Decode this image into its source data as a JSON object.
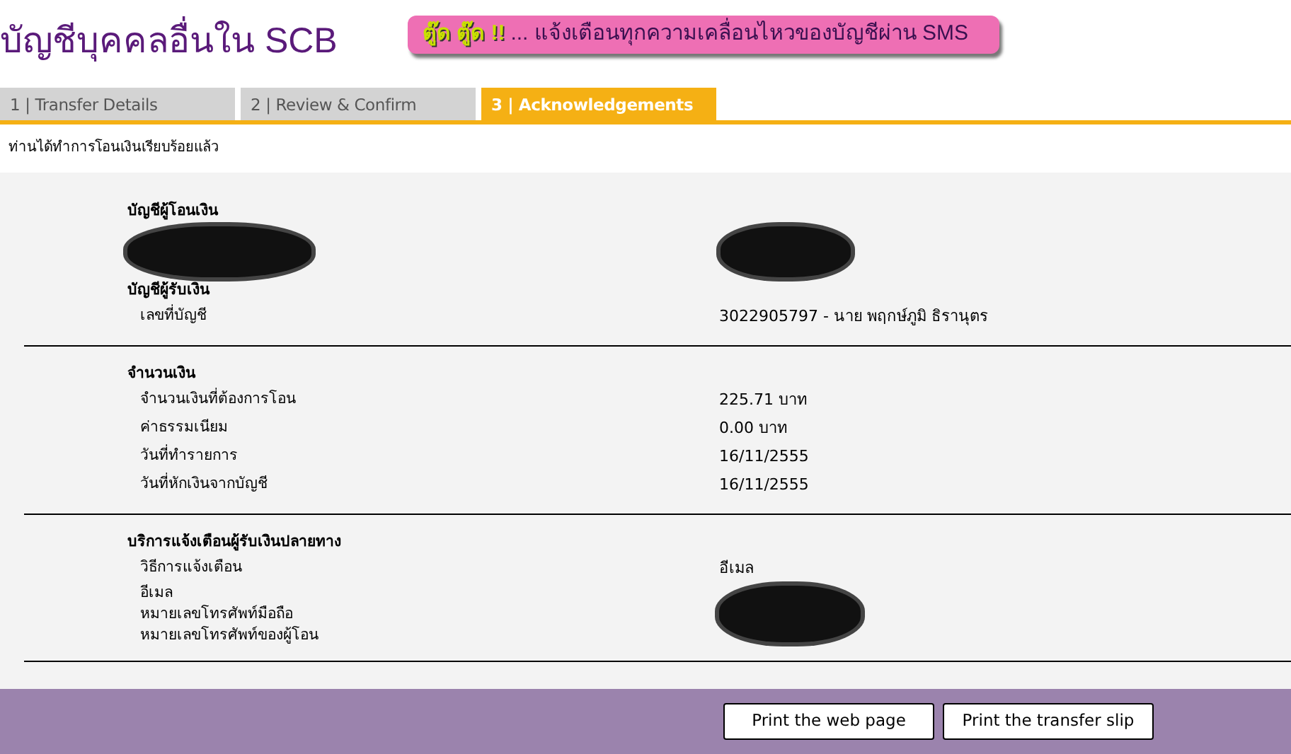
{
  "header": {
    "title": "บัญชีบุคคลอื่นใน SCB",
    "banner": {
      "highlight": "ตู๊ด ตู๊ด !!",
      "text": "... แจ้งเตือนทุกความเคลื่อนไหวของบัญชีผ่าน SMS"
    }
  },
  "tabs": [
    {
      "label": "1 | Transfer Details",
      "selected": false
    },
    {
      "label": "2 | Review & Confirm",
      "selected": false
    },
    {
      "label": "3 | Acknowledgements",
      "selected": true
    }
  ],
  "message": "ท่านได้ทำการโอนเงินเรียบร้อยแล้ว",
  "sections": [
    {
      "items": [
        {
          "kind": "heading",
          "label": "บัญชีผู้โอนเงิน"
        },
        {
          "kind": "hidden"
        },
        {
          "kind": "heading",
          "label": "บัญชีผู้รับเงิน"
        },
        {
          "kind": "row",
          "label": "เลขที่บัญชี",
          "value": "3022905797 - นาย พฤกษ์ภูมิ ธิรานุตร"
        }
      ]
    },
    {
      "items": [
        {
          "kind": "heading",
          "label": "จำนวนเงิน"
        },
        {
          "kind": "row",
          "label": "จำนวนเงินที่ต้องการโอน",
          "value": "225.71 บาท"
        },
        {
          "kind": "row",
          "label": "ค่าธรรมเนียม",
          "value": "0.00  บาท"
        },
        {
          "kind": "row",
          "label": "วันที่ทำรายการ",
          "value": "16/11/2555"
        },
        {
          "kind": "row",
          "label": "วันที่หักเงินจากบัญชี",
          "value": "16/11/2555"
        }
      ]
    },
    {
      "items": [
        {
          "kind": "heading",
          "label": "บริการแจ้งเตือนผู้รับเงินปลายทาง"
        },
        {
          "kind": "row",
          "label": "วิธีการแจ้งเตือน",
          "value": "อีเมล"
        },
        {
          "kind": "masked",
          "labels": [
            "อีเมล",
            "หมายเลขโทรศัพท์มือถือ",
            "หมายเลขโทรศัพท์ของผู้โอน"
          ]
        }
      ]
    }
  ],
  "buttons": [
    "Print the web page",
    "Print the transfer slip"
  ]
}
